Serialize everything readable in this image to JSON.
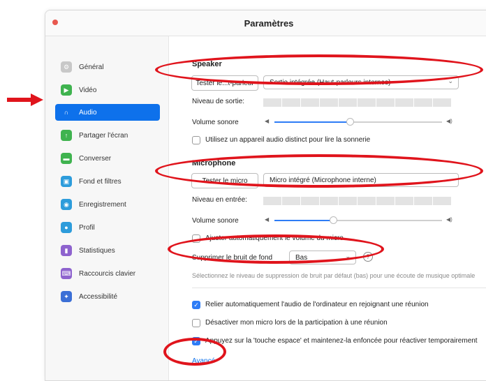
{
  "window": {
    "title": "Paramètres"
  },
  "sidebar": {
    "items": [
      {
        "label": "Général",
        "icon": "gear-icon",
        "color": "#c8c8c8",
        "active": false
      },
      {
        "label": "Vidéo",
        "icon": "video-camera-icon",
        "color": "#3fb34f",
        "active": false
      },
      {
        "label": "Audio",
        "icon": "headphones-icon",
        "color": "#0e71eb",
        "active": true
      },
      {
        "label": "Partager l'écran",
        "icon": "share-screen-icon",
        "color": "#3fb34f",
        "active": false
      },
      {
        "label": "Converser",
        "icon": "chat-bubble-icon",
        "color": "#3fb34f",
        "active": false
      },
      {
        "label": "Fond et filtres",
        "icon": "person-background-icon",
        "color": "#2d9cdb",
        "active": false
      },
      {
        "label": "Enregistrement",
        "icon": "record-icon",
        "color": "#2d9cdb",
        "active": false
      },
      {
        "label": "Profil",
        "icon": "profile-icon",
        "color": "#2d9cdb",
        "active": false
      },
      {
        "label": "Statistiques",
        "icon": "bar-chart-icon",
        "color": "#8e63ce",
        "active": false
      },
      {
        "label": "Raccourcis clavier",
        "icon": "keyboard-icon",
        "color": "#8e63ce",
        "active": false
      },
      {
        "label": "Accessibilité",
        "icon": "accessibility-icon",
        "color": "#3b6fd6",
        "active": false
      }
    ]
  },
  "speaker": {
    "heading": "Speaker",
    "test_button": "Tester le...t-parleur",
    "device": "Sortie intégrée (Haut-parleurs internes)",
    "output_level_label": "Niveau de sortie:",
    "volume_label": "Volume sonore",
    "volume_level": 0.45,
    "separate_device_label": "Utilisez un appareil audio distinct pour lire la sonnerie",
    "separate_device_checked": false
  },
  "microphone": {
    "heading": "Microphone",
    "test_button": "Tester le micro",
    "device": "Micro intégré (Microphone interne)",
    "input_level_label": "Niveau en entrée:",
    "volume_label": "Volume sonore",
    "volume_level": 0.35,
    "auto_adjust_label": "Ajuster automatiquement le volume du micro",
    "auto_adjust_checked": false
  },
  "noise": {
    "label": "Supprimer le bruit de fond",
    "value": "Bas",
    "help": "?",
    "hint": "Sélectionnez le niveau de suppression de bruit par défaut (bas) pour une écoute de musique optimale"
  },
  "options": [
    {
      "label": "Relier automatiquement l'audio de l'ordinateur en rejoignant une réunion",
      "checked": true
    },
    {
      "label": "Désactiver mon micro lors de la participation à une réunion",
      "checked": false
    },
    {
      "label": "Appuyez sur la 'touche espace' et maintenez-la enfoncée pour réactiver temporairement",
      "checked": true
    }
  ],
  "advanced_link": "Avancé",
  "annotation_color": "#e0141c"
}
